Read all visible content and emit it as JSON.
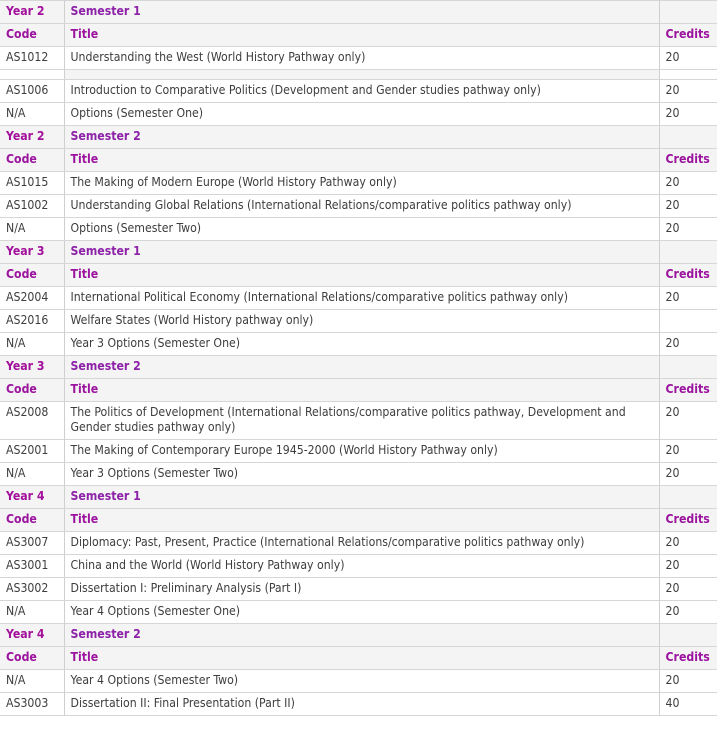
{
  "table": {
    "columns": {
      "code": "Code",
      "title": "Title",
      "credits": "Credits"
    },
    "colors": {
      "year_label": "#a3109b",
      "semester_label": "#8d21a8",
      "column_header": "#9b139e",
      "band_background": "#f4f4f4",
      "row_background": "#ffffff",
      "border": "#d6d6d6",
      "body_text": "#3d3d3d"
    },
    "sections": [
      {
        "year": "Year 2",
        "semester": "Semester 1",
        "rows": [
          {
            "type": "data",
            "code": "AS1012",
            "title": "Understanding the West (World History Pathway only)",
            "credits": "20"
          },
          {
            "type": "spacer",
            "code": "",
            "title": "",
            "credits": ""
          },
          {
            "type": "data",
            "code": "AS1006",
            "title": "Introduction to Comparative Politics (Development and Gender studies pathway only)",
            "credits": "20"
          },
          {
            "type": "data",
            "code": "N/A",
            "title": "Options (Semester One)",
            "credits": "20"
          }
        ]
      },
      {
        "year": "Year 2",
        "semester": "Semester 2",
        "rows": [
          {
            "type": "data",
            "code": "AS1015",
            "title": "The Making of Modern Europe (World History Pathway only)",
            "credits": "20"
          },
          {
            "type": "data",
            "code": "AS1002",
            "title": "Understanding Global Relations (International Relations/comparative politics pathway only)",
            "credits": "20"
          },
          {
            "type": "data",
            "code": "N/A",
            "title": "Options (Semester Two)",
            "credits": "20"
          }
        ]
      },
      {
        "year": "Year 3",
        "semester": "Semester 1",
        "rows": [
          {
            "type": "data",
            "code": "AS2004",
            "title": "International Political Economy (International Relations/comparative politics pathway only)",
            "credits": "20"
          },
          {
            "type": "data",
            "code": "AS2016",
            "title": "Welfare States (World History pathway only)",
            "credits": ""
          },
          {
            "type": "data",
            "code": "N/A",
            "title": "Year 3 Options (Semester One)",
            "credits": "20"
          }
        ]
      },
      {
        "year": "Year 3",
        "semester": "Semester 2",
        "rows": [
          {
            "type": "data",
            "code": "AS2008",
            "title": "The Politics of Development (International Relations/comparative politics pathway, Development and Gender studies pathway only)",
            "credits": "20"
          },
          {
            "type": "data",
            "code": "AS2001",
            "title": "The Making of Contemporary Europe 1945-2000 (World History Pathway only)",
            "credits": "20"
          },
          {
            "type": "data",
            "code": "N/A",
            "title": "Year 3 Options (Semester Two)",
            "credits": "20"
          }
        ]
      },
      {
        "year": "Year 4",
        "semester": "Semester 1",
        "rows": [
          {
            "type": "data",
            "code": "AS3007",
            "title": "Diplomacy: Past, Present, Practice (International Relations/comparative politics pathway only)",
            "credits": "20"
          },
          {
            "type": "data",
            "code": "AS3001",
            "title": "China and the World (World History Pathway only)",
            "credits": "20"
          },
          {
            "type": "data",
            "code": "AS3002",
            "title": "Dissertation I: Preliminary Analysis (Part I)",
            "credits": "20"
          },
          {
            "type": "data",
            "code": "N/A",
            "title": "Year 4 Options (Semester One)",
            "credits": "20"
          }
        ]
      },
      {
        "year": "Year 4",
        "semester": "Semester 2",
        "rows": [
          {
            "type": "data",
            "code": "N/A",
            "title": "Year 4 Options (Semester Two)",
            "credits": "20"
          },
          {
            "type": "data",
            "code": "AS3003",
            "title": "Dissertation II: Final Presentation (Part II)",
            "credits": "40"
          }
        ]
      }
    ]
  }
}
